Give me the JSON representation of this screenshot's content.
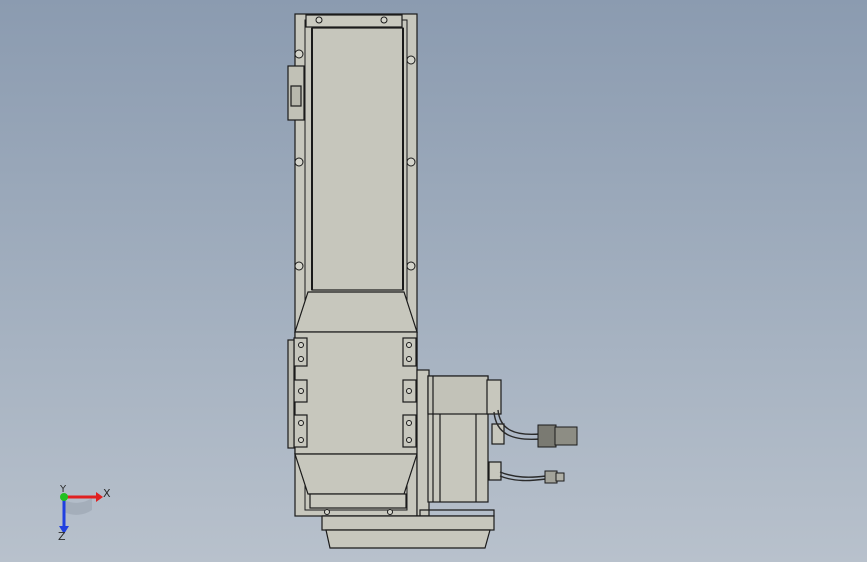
{
  "viewport": {
    "background_top": "#8b9bb0",
    "background_bottom": "#b8c1cc",
    "model_fill": "#c7c7bd",
    "model_stroke": "#1a1a1a"
  },
  "triad": {
    "x_label": "X",
    "y_label": "Y",
    "z_label": "Z",
    "x_color": "#e02020",
    "y_color": "#20c020",
    "z_color": "#2040e0"
  }
}
